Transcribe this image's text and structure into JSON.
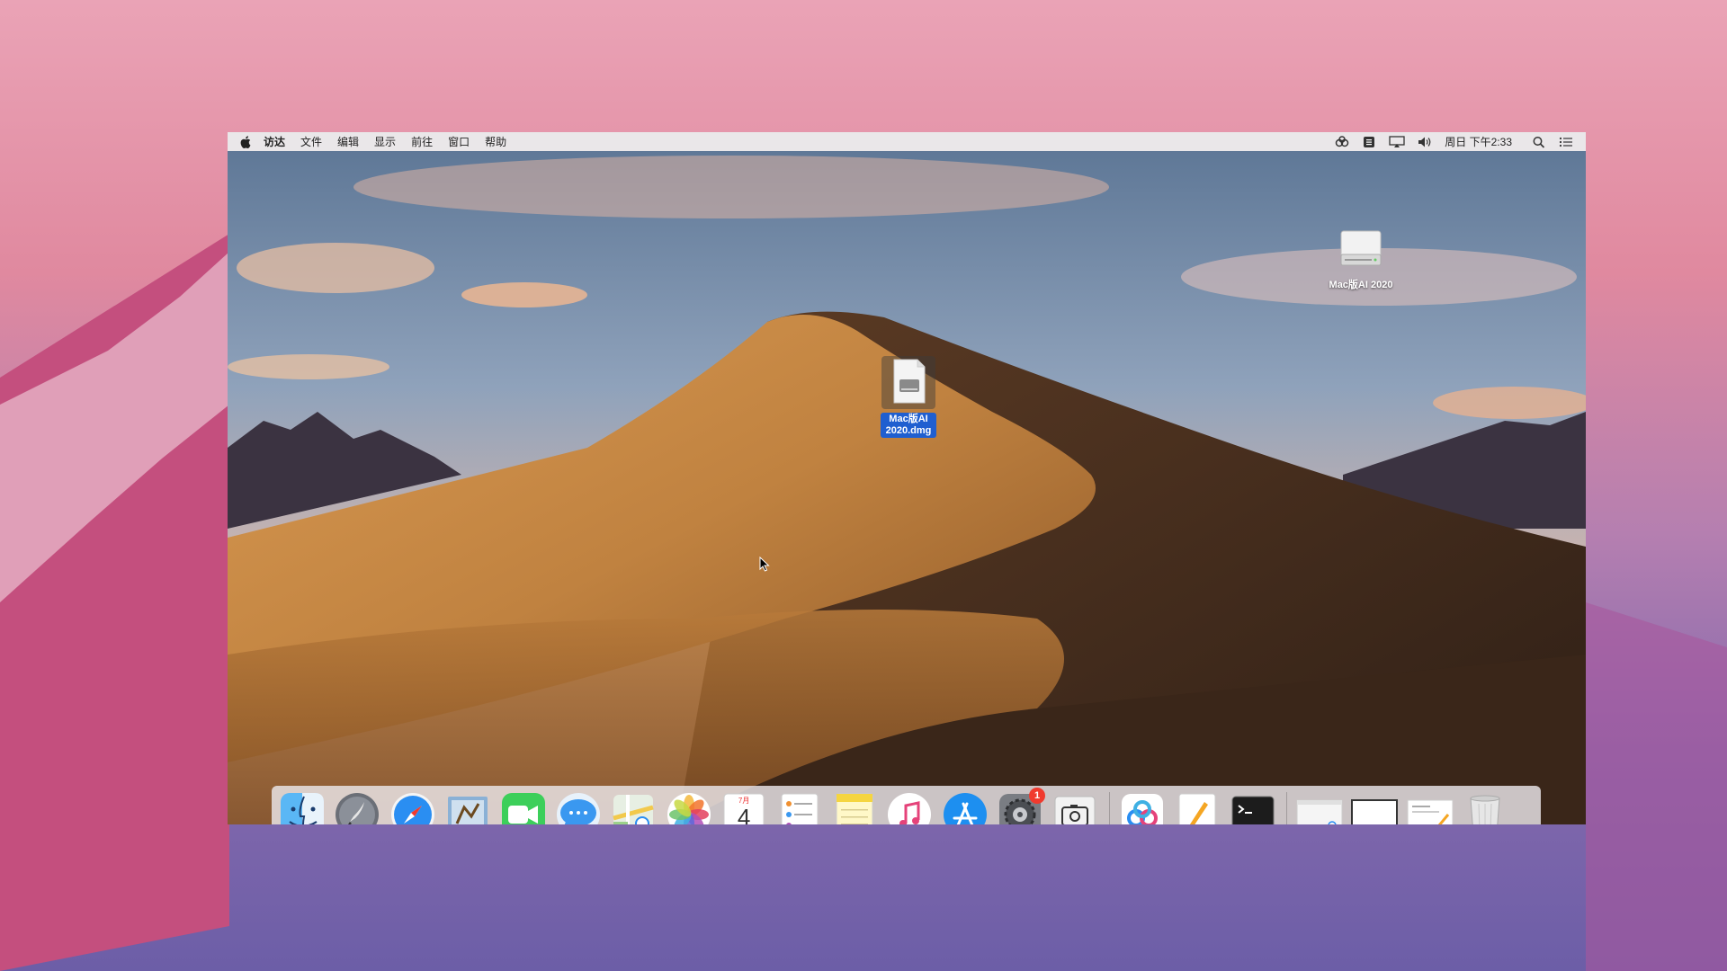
{
  "menubar": {
    "menus": [
      "访达",
      "文件",
      "编辑",
      "显示",
      "前往",
      "窗口",
      "帮助"
    ],
    "clock": "周日 下午2:33",
    "status_icons": [
      "baidu-netdisk-icon",
      "input-method-icon",
      "airplay-display-icon",
      "volume-icon",
      "spotlight-search-icon",
      "notification-center-icon"
    ]
  },
  "desktop": {
    "file_icon_label": "Mac版AI 2020.dmg",
    "drive_icon_label": "Mac版AI 2020",
    "selection_color": "#1f5fd0"
  },
  "dock": {
    "apps": [
      {
        "name": "finder",
        "running": true
      },
      {
        "name": "launchpad",
        "running": false
      },
      {
        "name": "safari",
        "running": false
      },
      {
        "name": "mail",
        "running": false
      },
      {
        "name": "facetime",
        "running": false
      },
      {
        "name": "messages",
        "running": false
      },
      {
        "name": "maps",
        "running": false
      },
      {
        "name": "photos",
        "running": false
      },
      {
        "name": "calendar",
        "running": false
      },
      {
        "name": "reminders",
        "running": false
      },
      {
        "name": "notes",
        "running": false
      },
      {
        "name": "itunes",
        "running": true
      },
      {
        "name": "app-store",
        "running": false
      },
      {
        "name": "system-preferences",
        "running": false,
        "badge": "1"
      },
      {
        "name": "screenshot",
        "running": false
      }
    ],
    "calendar_month": "7月",
    "calendar_day": "4",
    "system_preferences_badge": "1",
    "recent_apps": [
      "baidu-netdisk",
      "pages",
      "terminal"
    ],
    "recent_items": [
      "baidu-netdisk-window-thumbnail",
      "blank-window-thumbnail",
      "document-thumbnail",
      "trash"
    ]
  }
}
